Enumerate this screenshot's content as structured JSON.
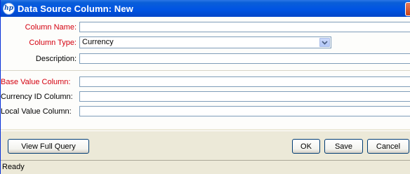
{
  "window": {
    "title": "Data Source Column: New",
    "logo_text": "hp",
    "close_glyph": "✕"
  },
  "form": {
    "column_name": {
      "label": "Column Name:",
      "value": ""
    },
    "column_type": {
      "label": "Column Type:",
      "value": "Currency"
    },
    "description": {
      "label": "Description:",
      "value": ""
    },
    "base_value_column": {
      "label": "Base Value Column:",
      "value": ""
    },
    "currency_id_column": {
      "label": "Currency ID Column:",
      "value": ""
    },
    "local_value_column": {
      "label": "Local Value Column:",
      "value": ""
    }
  },
  "buttons": {
    "view_full_query": "View Full Query",
    "ok": "OK",
    "save": "Save",
    "cancel": "Cancel"
  },
  "status": {
    "text": "Ready"
  },
  "colors": {
    "required_label": "#d4000f",
    "titlebar": "#0054e3"
  }
}
